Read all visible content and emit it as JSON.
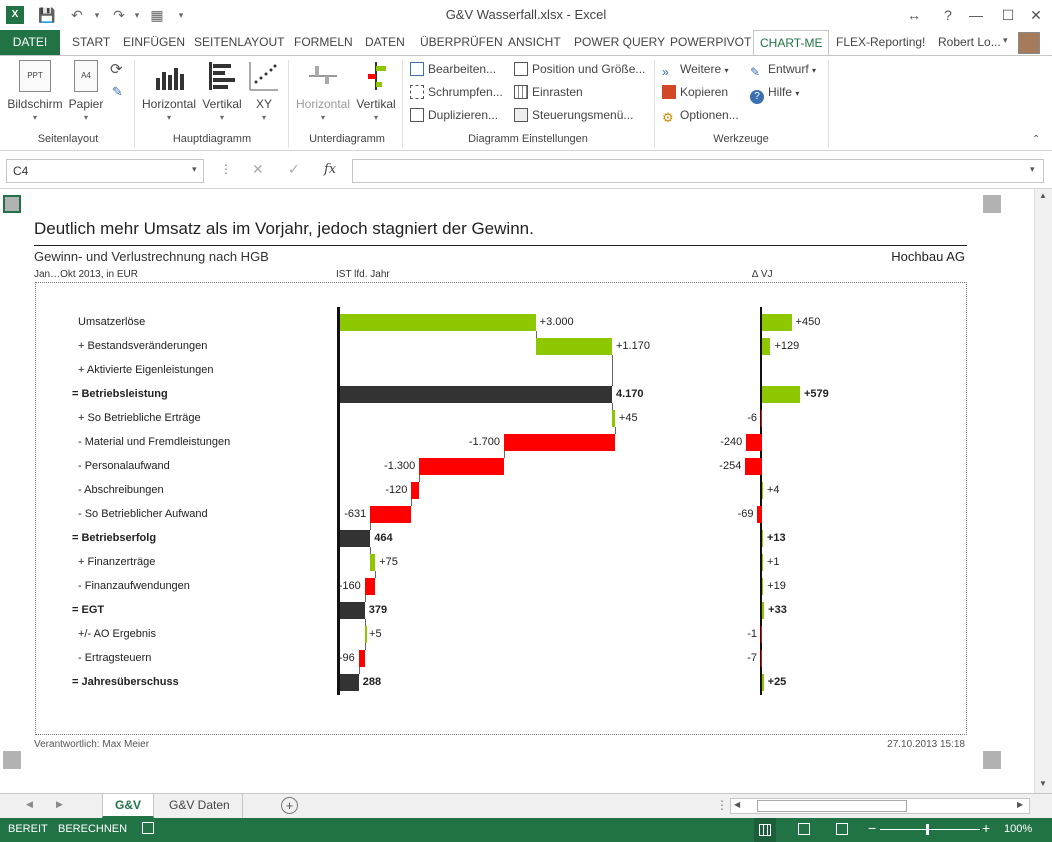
{
  "window": {
    "title": "G&V Wasserfall.xlsx - Excel",
    "user": "Robert Lo...",
    "help_label": "?"
  },
  "ribbon_tabs": [
    {
      "label": "DATEI"
    },
    {
      "label": "START"
    },
    {
      "label": "EINFÜGEN"
    },
    {
      "label": "SEITENLAYOUT"
    },
    {
      "label": "FORMELN"
    },
    {
      "label": "DATEN"
    },
    {
      "label": "ÜBERPRÜFEN"
    },
    {
      "label": "ANSICHT"
    },
    {
      "label": "POWER QUERY"
    },
    {
      "label": "POWERPIVOT"
    },
    {
      "label": "CHART-ME"
    },
    {
      "label": "FLEX-Reporting!"
    }
  ],
  "ribbon": {
    "groups": {
      "seitenlayout": {
        "label": "Seitenlayout",
        "bildschirm": "Bildschirm",
        "papier": "Papier",
        "ppt_icon": "PPT",
        "a4_icon": "A4"
      },
      "hauptdiagramm": {
        "label": "Hauptdiagramm",
        "horizontal": "Horizontal",
        "vertikal": "Vertikal",
        "xy": "XY"
      },
      "unterdiagramm": {
        "label": "Unterdiagramm",
        "horizontal": "Horizontal",
        "vertikal": "Vertikal"
      },
      "einstellungen": {
        "label": "Diagramm Einstellungen",
        "bearbeiten": "Bearbeiten...",
        "schrumpfen": "Schrumpfen...",
        "duplizieren": "Duplizieren...",
        "position": "Position und Größe...",
        "einrasten": "Einrasten",
        "steuerung": "Steuerungsmenü..."
      },
      "werkzeuge": {
        "label": "Werkzeuge",
        "weitere": "Weitere",
        "kopieren": "Kopieren",
        "optionen": "Optionen...",
        "entwurf": "Entwurf",
        "hilfe": "Hilfe"
      }
    }
  },
  "formula_bar": {
    "name_box": "C4",
    "fx_label": "fx",
    "formula": ""
  },
  "report": {
    "headline": "Deutlich mehr Umsatz als im Vorjahr, jedoch stagniert der Gewinn.",
    "subtitle": "Gewinn- und Verlustrechnung nach HGB",
    "company": "Hochbau AG",
    "period": "Jan…Okt 2013, in EUR",
    "col_ist": "IST lfd. Jahr",
    "col_vj": "∆ VJ",
    "footer_left": "Verantwortlich: Max Meier",
    "footer_right": "27.10.2013 15:18"
  },
  "chart_data": {
    "type": "bar",
    "categories": [
      "Umsatzerlöse",
      "+ Bestandsveränderungen",
      "+ Aktivierte Eigenleistungen",
      "= Betriebsleistung",
      "+ So Betriebliche Erträge",
      "- Material und Fremdleistungen",
      "- Personalaufwand",
      "- Abschreibungen",
      "- So Betrieblicher Aufwand",
      "= Betriebserfolg",
      "+ Finanzerträge",
      "- Finanzaufwendungen",
      "= EGT",
      "+/- AO Ergebnis",
      "- Ertragsteuern",
      "= Jahresüberschuss"
    ],
    "series": [
      {
        "name": "IST lfd. Jahr",
        "values": [
          3000,
          1170,
          0,
          4170,
          45,
          -1700,
          -1300,
          -120,
          -631,
          464,
          75,
          -160,
          379,
          5,
          -96,
          288
        ],
        "labels": [
          "+3.000",
          "+1.170",
          "",
          "4.170",
          "+45",
          "-1.700",
          "-1.300",
          "-120",
          "-631",
          "464",
          "+75",
          "-160",
          "379",
          "+5",
          "-96",
          "288"
        ],
        "is_total": [
          false,
          false,
          false,
          true,
          false,
          false,
          false,
          false,
          false,
          true,
          false,
          false,
          true,
          false,
          false,
          true
        ]
      },
      {
        "name": "∆ VJ",
        "values": [
          450,
          129,
          0,
          579,
          -6,
          -240,
          -254,
          4,
          -69,
          13,
          1,
          19,
          33,
          -1,
          -7,
          25
        ],
        "labels": [
          "+450",
          "+129",
          "",
          "+579",
          "-6",
          "-240",
          "-254",
          "+4",
          "-69",
          "+13",
          "+1",
          "+19",
          "+33",
          "-1",
          "-7",
          "+25"
        ]
      }
    ],
    "colors": {
      "positive": "#8cc700",
      "negative": "#ff0000",
      "total": "#333333"
    }
  },
  "sheet_tabs": [
    {
      "label": "G&V"
    },
    {
      "label": "G&V Daten"
    }
  ],
  "status": {
    "ready": "BEREIT",
    "calc": "BERECHNEN",
    "zoom": "100%"
  }
}
